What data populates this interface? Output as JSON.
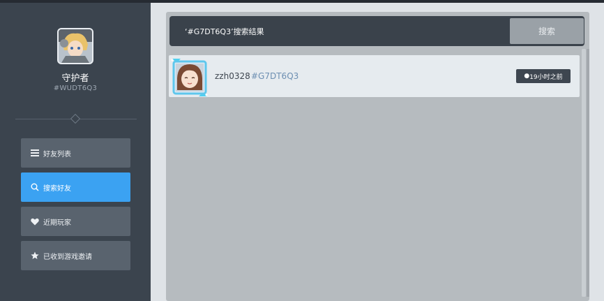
{
  "profile": {
    "name": "守护者",
    "id": "#WUDT6Q3"
  },
  "nav": {
    "items": [
      {
        "label": "好友列表",
        "icon": "list-icon"
      },
      {
        "label": "搜索好友",
        "icon": "search-icon",
        "active": true
      },
      {
        "label": "近期玩家",
        "icon": "heart-icon"
      },
      {
        "label": "已收到游戏邀请",
        "icon": "star-icon"
      }
    ]
  },
  "search": {
    "title": "‘#G7DT6Q3’搜索结果",
    "button_label": "搜索"
  },
  "results": [
    {
      "name": "zzh0328",
      "id": "#G7DT6Q3",
      "status_dot": "●",
      "last_seen": "19小时之前"
    }
  ],
  "colors": {
    "accent": "#3ba2f2",
    "sidebar": "#3b444e",
    "nav_item": "#59636e",
    "panel": "#b6bbbf",
    "searchbar": "#3a424b"
  }
}
